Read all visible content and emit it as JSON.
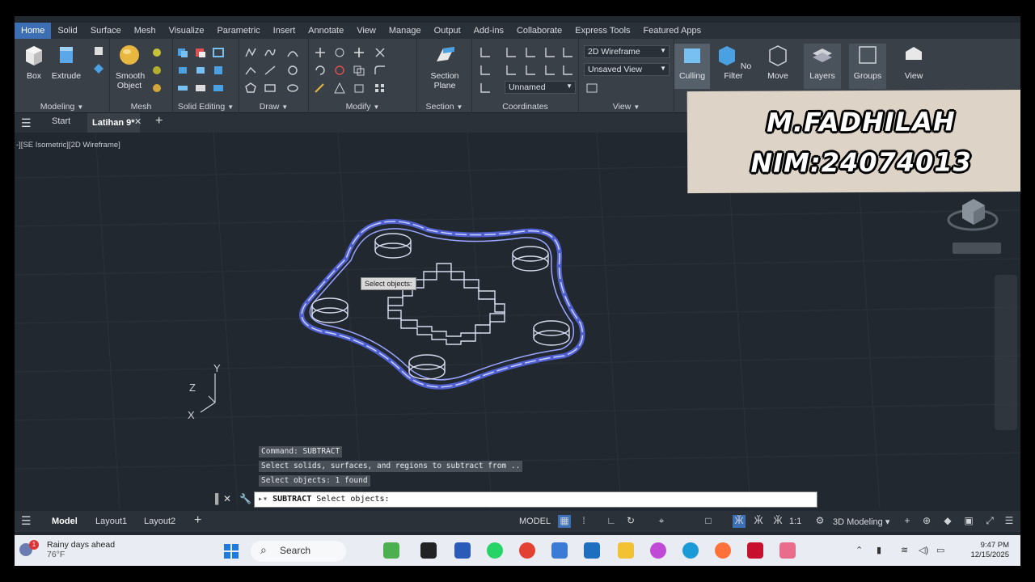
{
  "ribbon_tabs": [
    "Home",
    "Solid",
    "Surface",
    "Mesh",
    "Visualize",
    "Parametric",
    "Insert",
    "Annotate",
    "View",
    "Manage",
    "Output",
    "Add-ins",
    "Collaborate",
    "Express Tools",
    "Featured Apps"
  ],
  "ribbon": {
    "box": "Box",
    "extrude": "Extrude",
    "smooth_object": "Smooth Object",
    "section_plane": "Section Plane",
    "visual_style": "2D Wireframe",
    "saved_view": "Unsaved View",
    "ucs_name": "Unnamed",
    "culling": "Culling",
    "no_filter": "No Filter",
    "move": "Move",
    "layers": "Layers",
    "groups": "Groups",
    "view_btn": "View",
    "panels": {
      "modeling": "Modeling",
      "mesh": "Mesh",
      "solid_editing": "Solid Editing",
      "draw": "Draw",
      "modify": "Modify",
      "section": "Section",
      "coordinates": "Coordinates",
      "view": "View"
    }
  },
  "file_tabs": {
    "start": "Start",
    "current": "Latihan 9*"
  },
  "viewport_label": "-][SE Isometric][2D Wireframe]",
  "tooltip": "Select objects:",
  "overlay": {
    "name": "M.FADHILAH",
    "nim": "NIM:24074013"
  },
  "axes": {
    "x": "X",
    "y": "Y",
    "z": "Z"
  },
  "command_history": [
    "Command: SUBTRACT",
    "Select solids, surfaces, and regions to subtract from ..",
    "Select objects: 1 found"
  ],
  "command_prompt": {
    "command": "SUBTRACT",
    "text": "Select objects:"
  },
  "status_bar": {
    "tabs": [
      "Model",
      "Layout1",
      "Layout2"
    ],
    "model_label": "MODEL",
    "scale": "1:1",
    "workspace": "3D Modeling"
  },
  "taskbar": {
    "weather_title": "Rainy days ahead",
    "weather_temp": "76°F",
    "weather_badge": "1",
    "search_placeholder": "Search",
    "time": "9:47 PM",
    "date": "12/15/2025"
  },
  "colors": {
    "accent": "#3d6fb5",
    "canvas": "#212830",
    "selection": "#6a78ff"
  }
}
